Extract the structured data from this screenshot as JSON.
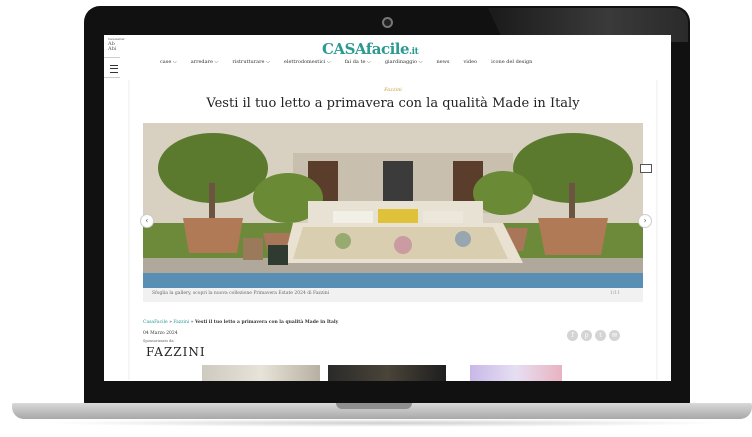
{
  "left_menu": {
    "lines": [
      "Newsletter",
      "Ab",
      "Abi"
    ]
  },
  "site": {
    "logo": "CASAfacile",
    "logo_suffix": ".it"
  },
  "nav": [
    "case",
    "arredare",
    "ristrutturare",
    "elettrodomestici",
    "fai da te",
    "giardinaggio",
    "news",
    "video",
    "icone del design"
  ],
  "article": {
    "kicker": "Fazzini",
    "title": "Vesti il tuo letto a primavera con la qualità Made in Italy",
    "caption": "Sfoglia la gallery, scopri la nuova collezione Primavera Estate 2024 di Fazzini",
    "counter": "1/11",
    "breadcrumb": {
      "home": "CasaFacile",
      "section": "Fazzini",
      "current": "Vesti il tuo letto a primavera con la qualità Made in Italy"
    },
    "date": "04 Marzo 2024",
    "sponsor_label": "Sponsorizzato da:",
    "brand": "FAZZINI"
  },
  "share": [
    "f",
    "p",
    "t",
    "✉"
  ],
  "colors": {
    "brand": "#2a9a93",
    "kicker": "#c79a3a"
  }
}
